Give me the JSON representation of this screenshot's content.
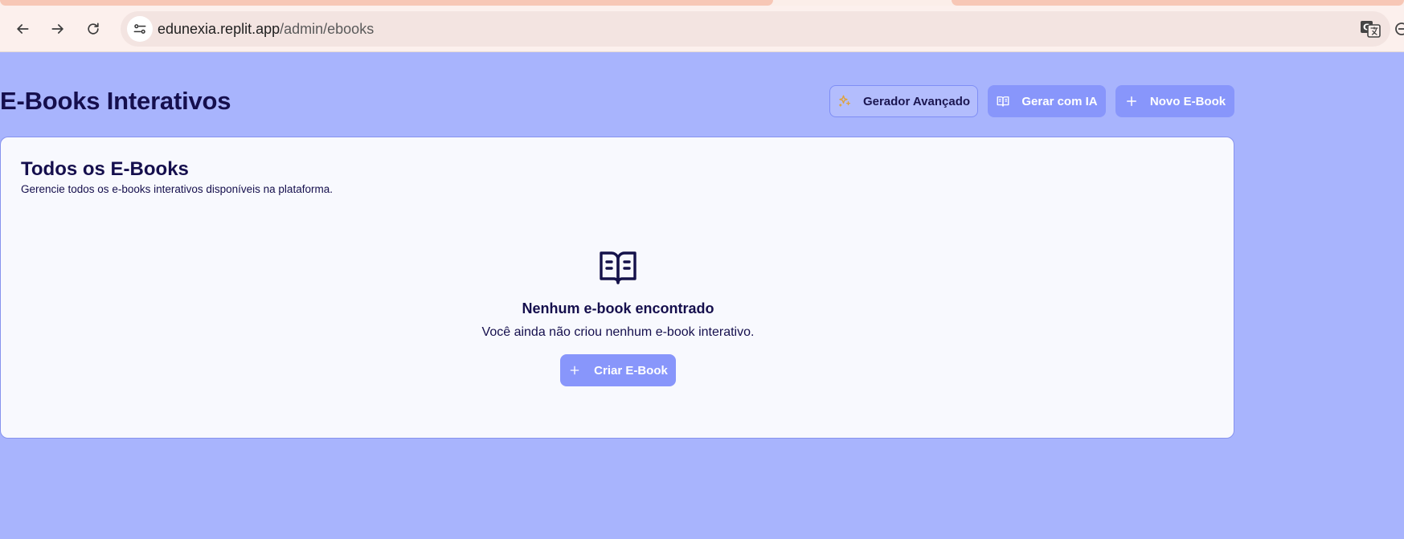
{
  "browser": {
    "url_host": "edunexia.replit.app",
    "url_path": "/admin/ebooks",
    "icons": [
      "back-arrow-icon",
      "forward-arrow-icon",
      "reload-icon",
      "site-settings-icon",
      "translate-icon"
    ]
  },
  "page": {
    "title": "E-Books Interativos",
    "actions": {
      "advanced_generator": "Gerador Avançado",
      "generate_ai": "Gerar com IA",
      "new_ebook": "Novo E-Book"
    }
  },
  "card": {
    "title": "Todos os E-Books",
    "subtitle": "Gerencie todos os e-books interativos disponíveis na plataforma.",
    "empty_state": {
      "icon": "open-book-icon",
      "title": "Nenhum e-book encontrado",
      "message": "Você ainda não criou nenhum e-book interativo.",
      "button_label": "Criar E-Book"
    }
  },
  "colors": {
    "page_background": "#a8b4fd",
    "primary_button": "#8896fb",
    "title_text": "#150f4d",
    "card_background": "#f8f9fe",
    "sparkle_accent": "#e0a23a"
  }
}
